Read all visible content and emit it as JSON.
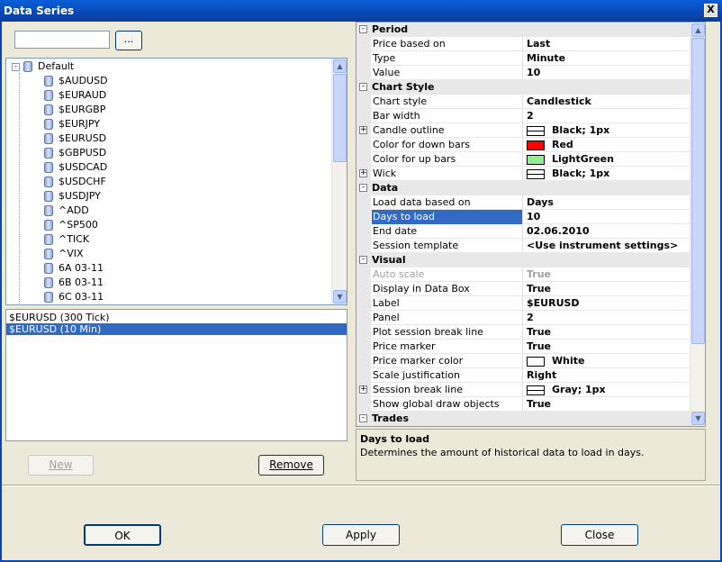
{
  "window": {
    "title": "Data Series",
    "close_glyph": "X"
  },
  "search": {
    "value": "",
    "browse_label": "..."
  },
  "tree": {
    "root": "Default",
    "expander": "-",
    "items": [
      "$AUDUSD",
      "$EURAUD",
      "$EURGBP",
      "$EURJPY",
      "$EURUSD",
      "$GBPUSD",
      "$USDCAD",
      "$USDCHF",
      "$USDJPY",
      "^ADD",
      "^SP500",
      "^TICK",
      "^VIX",
      "6A 03-11",
      "6B 03-11",
      "6C 03-11"
    ]
  },
  "series_list": {
    "items": [
      "$EURUSD (300 Tick)",
      "$EURUSD (10 Min)"
    ],
    "selected_index": 1
  },
  "buttons": {
    "new": "New",
    "remove": "Remove",
    "ok": "OK",
    "apply": "Apply",
    "close": "Close"
  },
  "scroll_glyphs": {
    "up": "▲",
    "down": "▼"
  },
  "property_grid": {
    "expanded_glyph": "-",
    "collapsed_glyph": "+",
    "rows": [
      {
        "kind": "cat",
        "label": "Period"
      },
      {
        "kind": "prop",
        "name": "Price based on",
        "value": "Last"
      },
      {
        "kind": "prop",
        "name": "Type",
        "value": "Minute"
      },
      {
        "kind": "prop",
        "name": "Value",
        "value": "10"
      },
      {
        "kind": "cat",
        "label": "Chart Style"
      },
      {
        "kind": "prop",
        "name": "Chart style",
        "value": "Candlestick"
      },
      {
        "kind": "prop",
        "name": "Bar width",
        "value": "2"
      },
      {
        "kind": "prop",
        "name": "Candle outline",
        "value": "Black; 1px",
        "expand": true,
        "line": true,
        "normal": true
      },
      {
        "kind": "prop",
        "name": "Color for down bars",
        "value": "Red",
        "color": "#ff0000"
      },
      {
        "kind": "prop",
        "name": "Color for up bars",
        "value": "LightGreen",
        "color": "#90ee90"
      },
      {
        "kind": "prop",
        "name": "Wick",
        "value": "Black; 1px",
        "expand": true,
        "line": true,
        "normal": true
      },
      {
        "kind": "cat",
        "label": "Data"
      },
      {
        "kind": "prop",
        "name": "Load data based on",
        "value": "Days"
      },
      {
        "kind": "prop",
        "name": "Days to load",
        "value": "10",
        "selected": true,
        "normal": true
      },
      {
        "kind": "prop",
        "name": "End date",
        "value": "02.06.2010"
      },
      {
        "kind": "prop",
        "name": "Session template",
        "value": "<Use instrument settings>"
      },
      {
        "kind": "cat",
        "label": "Visual"
      },
      {
        "kind": "prop",
        "name": "Auto scale",
        "value": "True",
        "disabled": true
      },
      {
        "kind": "prop",
        "name": "Display in Data Box",
        "value": "True"
      },
      {
        "kind": "prop",
        "name": "Label",
        "value": "$EURUSD"
      },
      {
        "kind": "prop",
        "name": "Panel",
        "value": "2"
      },
      {
        "kind": "prop",
        "name": "Plot session break line",
        "value": "True"
      },
      {
        "kind": "prop",
        "name": "Price marker",
        "value": "True"
      },
      {
        "kind": "prop",
        "name": "Price marker color",
        "value": "White",
        "color": "#ffffff"
      },
      {
        "kind": "prop",
        "name": "Scale justification",
        "value": "Right"
      },
      {
        "kind": "prop",
        "name": "Session break line",
        "value": "Gray; 1px",
        "expand": true,
        "line": true
      },
      {
        "kind": "prop",
        "name": "Show global draw objects",
        "value": "True"
      },
      {
        "kind": "cat",
        "label": "Trades"
      }
    ]
  },
  "help": {
    "title": "Days to load",
    "text": "Determines the amount of historical data to load in days."
  }
}
